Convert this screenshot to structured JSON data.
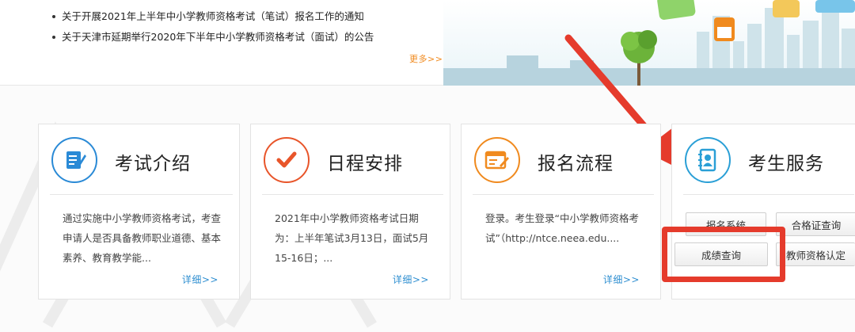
{
  "news": {
    "items": [
      "关于开展2021年上半年中小学教师资格考试（笔试）报名工作的通知",
      "关于天津市延期举行2020年下半年中小学教师资格考试（面试）的公告"
    ],
    "more_label": "更多>>"
  },
  "cards": [
    {
      "title": "考试介绍",
      "icon": "document-edit-icon",
      "accent": "#2a8ad6",
      "text": "通过实施中小学教师资格考试，考查申请人是否具备教师职业道德、基本素养、教育教学能...",
      "more_label": "详细>>"
    },
    {
      "title": "日程安排",
      "icon": "checkmark-icon",
      "accent": "#e8552a",
      "text": "2021年中小学教师资格考试日期为：上半年笔试3月13日，面试5月15-16日；...",
      "more_label": "详细>>"
    },
    {
      "title": "报名流程",
      "icon": "form-edit-icon",
      "accent": "#f08a1e",
      "text": "登录。考生登录“中小学教师资格考试”（http://ntce.neea.edu....",
      "more_label": "详细>>"
    },
    {
      "title": "考生服务",
      "icon": "contact-book-icon",
      "accent": "#2a9fd6"
    }
  ],
  "services": {
    "registration": "报名系统",
    "admission_ticket": "合格证查询",
    "score_query": "成绩查询",
    "certification": "教师资格认定"
  },
  "colors": {
    "annotation_red": "#e53b2c",
    "link_blue": "#2f8fd1",
    "more_orange": "#f08a1e"
  }
}
